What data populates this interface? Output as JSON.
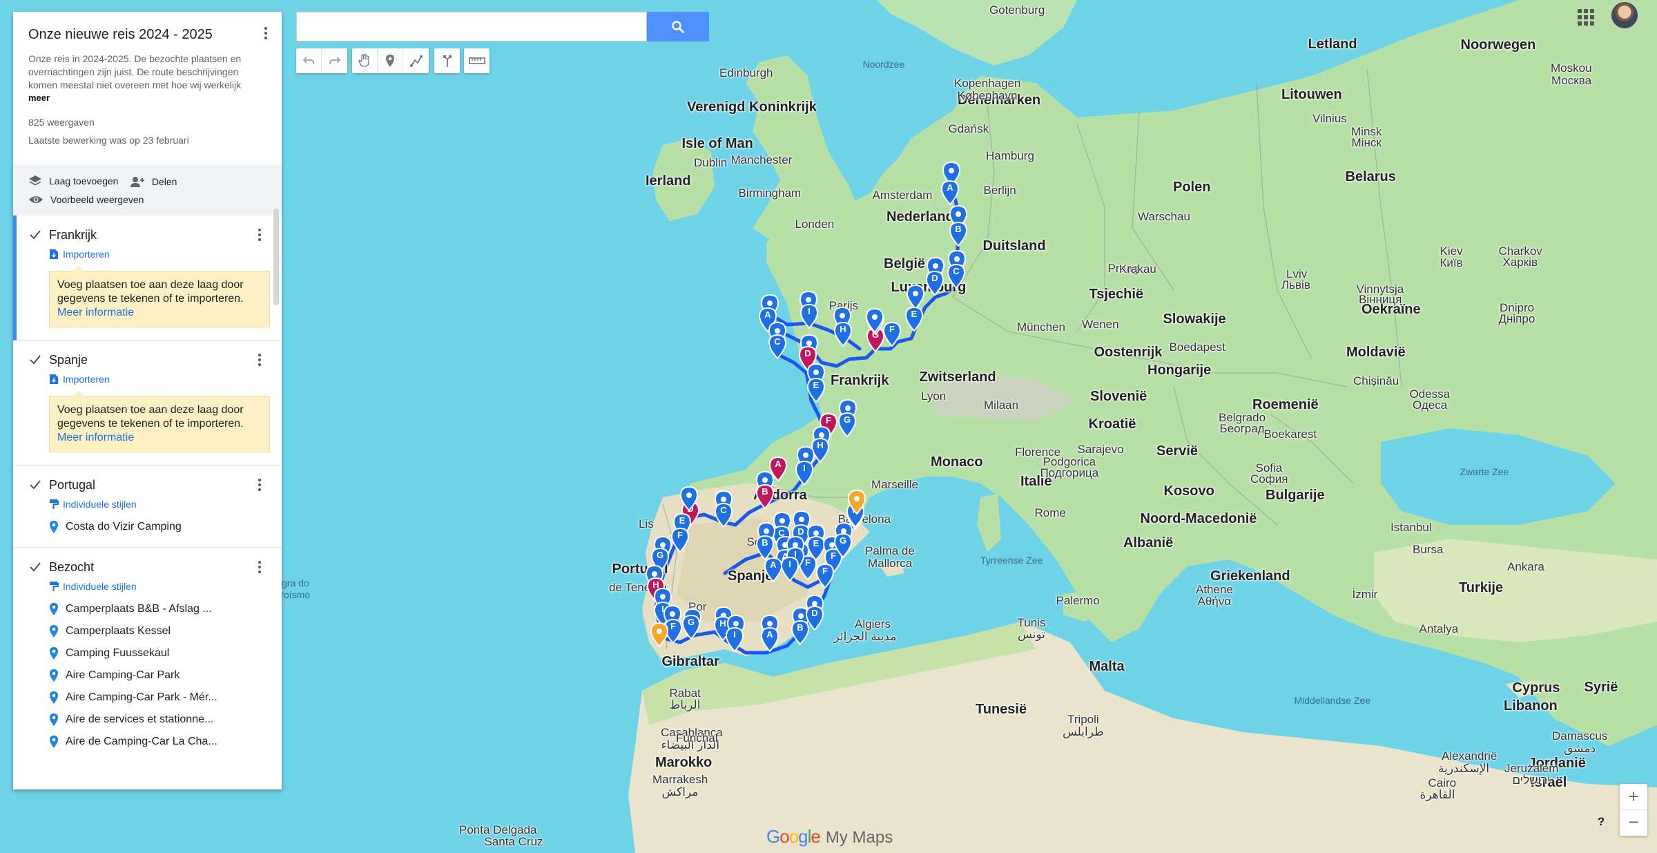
{
  "map": {
    "countries": [
      {
        "label": "Noorwegen"
      },
      {
        "label": "Letland"
      },
      {
        "label": "Litouwen"
      },
      {
        "label": "Belarus"
      },
      {
        "label": "Polen"
      },
      {
        "label": "Duitsland"
      },
      {
        "label": "Nederland"
      },
      {
        "label": "België"
      },
      {
        "label": "Luxemburg"
      },
      {
        "label": "Frankrijk"
      },
      {
        "label": "Tsjechië"
      },
      {
        "label": "Slowakije"
      },
      {
        "label": "Oostenrijk"
      },
      {
        "label": "Hongarije"
      },
      {
        "label": "Oekraïne"
      },
      {
        "label": "Moldavië"
      },
      {
        "label": "Roemenië"
      },
      {
        "label": "Slovenië"
      },
      {
        "label": "Kroatië"
      },
      {
        "label": "Servië"
      },
      {
        "label": "Bulgarije"
      },
      {
        "label": "Kosovo"
      },
      {
        "label": "Noord-Macedonië"
      },
      {
        "label": "Albanië"
      },
      {
        "label": "Griekenland"
      },
      {
        "label": "Turkije"
      },
      {
        "label": "Italië"
      },
      {
        "label": "Spanje"
      },
      {
        "label": "Portugal"
      },
      {
        "label": "Andorra"
      },
      {
        "label": "Monaco"
      },
      {
        "label": "Zwitserland"
      },
      {
        "label": "Ierland"
      },
      {
        "label": "Verenigd Koninkrijk"
      },
      {
        "label": "Isle of Man"
      },
      {
        "label": "Denemarken"
      },
      {
        "label": "Marokko"
      },
      {
        "label": "Tunesië"
      },
      {
        "label": "Malta"
      },
      {
        "label": "Cyprus"
      },
      {
        "label": "Syrië"
      },
      {
        "label": "Libanon"
      },
      {
        "label": "Israël"
      },
      {
        "label": "Jordanië"
      },
      {
        "label": "Gibraltar"
      }
    ],
    "cities": [
      {
        "label": "Gotenburg"
      },
      {
        "label": "Moskou"
      },
      {
        "label": "Москва"
      },
      {
        "label": "Edinburgh"
      },
      {
        "label": "Kopenhagen"
      },
      {
        "label": "København"
      },
      {
        "label": "Gdańsk"
      },
      {
        "label": "Vilnius"
      },
      {
        "label": "Minsk"
      },
      {
        "label": "Мінск"
      },
      {
        "label": "Manchester"
      },
      {
        "label": "Dublin"
      },
      {
        "label": "Birmingham"
      },
      {
        "label": "Hamburg"
      },
      {
        "label": "Amsterdam"
      },
      {
        "label": "Berlijn"
      },
      {
        "label": "Warschau"
      },
      {
        "label": "Kiev"
      },
      {
        "label": "Київ"
      },
      {
        "label": "Charkov"
      },
      {
        "label": "Харків"
      },
      {
        "label": "Londen"
      },
      {
        "label": "Praag"
      },
      {
        "label": "Krakau"
      },
      {
        "label": "Lviv"
      },
      {
        "label": "Львів"
      },
      {
        "label": "Vinnytsja"
      },
      {
        "label": "Вінниця"
      },
      {
        "label": "Dnipro"
      },
      {
        "label": "Дніпро"
      },
      {
        "label": "Parijs"
      },
      {
        "label": "München"
      },
      {
        "label": "Wenen"
      },
      {
        "label": "Boedapest"
      },
      {
        "label": "Chișinău"
      },
      {
        "label": "Odessa"
      },
      {
        "label": "Одеса"
      },
      {
        "label": "Lyon"
      },
      {
        "label": "Milaan"
      },
      {
        "label": "Belgrado"
      },
      {
        "label": "Београд"
      },
      {
        "label": "Boekarest"
      },
      {
        "label": "Florence"
      },
      {
        "label": "Sarajevo"
      },
      {
        "label": "Podgorica"
      },
      {
        "label": "Подгорица"
      },
      {
        "label": "Sofia"
      },
      {
        "label": "София"
      },
      {
        "label": "Marseille"
      },
      {
        "label": "Barcelona"
      },
      {
        "label": "Rome"
      },
      {
        "label": "Istanbul"
      },
      {
        "label": "Palma de"
      },
      {
        "label": "Mallorca"
      },
      {
        "label": "Bursa"
      },
      {
        "label": "Ankara"
      },
      {
        "label": "Athene"
      },
      {
        "label": "Αθήνα"
      },
      {
        "label": "İzmir"
      },
      {
        "label": "Palermo"
      },
      {
        "label": "Antalya"
      },
      {
        "label": "Algiers"
      },
      {
        "label": "مدينة الجزائر"
      },
      {
        "label": "Tunis"
      },
      {
        "label": "تونس"
      },
      {
        "label": "Rabat"
      },
      {
        "label": "الرباط"
      },
      {
        "label": "Tripoli"
      },
      {
        "label": "طرابلس"
      },
      {
        "label": "Damascus"
      },
      {
        "label": "دمشق"
      },
      {
        "label": "Casablanca"
      },
      {
        "label": "الدار البيضاء"
      },
      {
        "label": "Marrakesh"
      },
      {
        "label": "مراكش"
      },
      {
        "label": "Alexandrië"
      },
      {
        "label": "الإسكندرية"
      },
      {
        "label": "Jeruzalem"
      },
      {
        "label": "ירושלים"
      },
      {
        "label": "Cairo"
      },
      {
        "label": "القاهرة"
      },
      {
        "label": "Funchal"
      },
      {
        "label": "Ponta Delgada"
      },
      {
        "label": "Santa Cruz"
      },
      {
        "label": "de Tenerife"
      },
      {
        "label": "Lis"
      },
      {
        "label": "Por"
      },
      {
        "label": "Se"
      },
      {
        "label": "M"
      }
    ],
    "seas": [
      {
        "label": "Noordzee"
      },
      {
        "label": "Zwarte Zee"
      },
      {
        "label": "Tyrreense Zee"
      },
      {
        "label": "Middellandse Zee"
      },
      {
        "label": "gra do"
      },
      {
        "label": "eroísmo"
      }
    ],
    "pins": [
      {
        "letter": "A"
      },
      {
        "letter": "B"
      },
      {
        "letter": "C"
      },
      {
        "letter": "D"
      },
      {
        "letter": "E"
      },
      {
        "letter": "F"
      },
      {
        "letter": "G"
      },
      {
        "letter": "H"
      },
      {
        "letter": "I"
      }
    ],
    "route_color": "#1a56f0",
    "pin_color": "#1f6fe5",
    "pin_highlight_color": "#c2185b",
    "pin_current_color": "#f4a62a"
  },
  "search": {
    "placeholder": "",
    "value": ""
  },
  "toolbar": {
    "tools": [
      {
        "name": "undo-icon"
      },
      {
        "name": "redo-icon"
      },
      {
        "name": "hand-icon"
      },
      {
        "name": "marker-icon"
      },
      {
        "name": "draw-line-icon"
      },
      {
        "name": "directions-icon"
      },
      {
        "name": "ruler-icon"
      }
    ]
  },
  "panel": {
    "title": "Onze nieuwe reis 2024 - 2025",
    "description": "Onze reis in 2024-2025. De bezochte plaatsen en overnachtingen zijn juist. De route beschrijvingen komen meestal niet overeen met hoe wij werkelijk",
    "more": "meer",
    "views": "825 weergaven",
    "last_edit": "Laatste bewerking was op 23 februari",
    "actions": {
      "add_layer": "Laag toevoegen",
      "share": "Delen",
      "preview": "Voorbeeld weergeven"
    },
    "layers": [
      {
        "name": "Frankrijk",
        "link": "Importeren",
        "info": "Voeg plaatsen toe aan deze laag door gegevens te tekenen of te importeren.",
        "info_more": "Meer informatie"
      },
      {
        "name": "Spanje",
        "link": "Importeren",
        "info": "Voeg plaatsen toe aan deze laag door gegevens te tekenen of te importeren.",
        "info_more": "Meer informatie"
      },
      {
        "name": "Portugal",
        "link": "Individuele stijlen",
        "places": [
          "Costa do Vizir Camping"
        ]
      },
      {
        "name": "Bezocht",
        "link": "Individuele stijlen",
        "places": [
          "Camperplaats B&B - Afslag ...",
          "Camperplaats Kessel",
          "Camping Fuussekaul",
          "Aire Camping-Car Park",
          "Aire Camping-Car Park - Mér...",
          "Aire de services et stationne...",
          "Aire de Camping-Car La Cha..."
        ]
      }
    ]
  },
  "footer": {
    "brand_google": "Google",
    "brand_product": "My Maps",
    "zoom_in": "+",
    "zoom_out": "−",
    "help": "?"
  }
}
